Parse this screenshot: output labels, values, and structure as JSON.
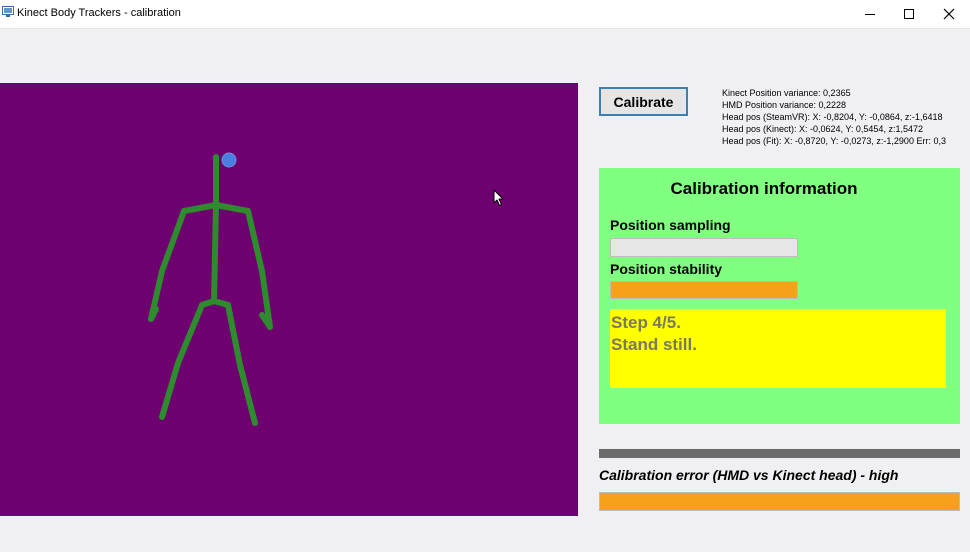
{
  "window": {
    "title": "Kinect Body Trackers - calibration",
    "controls": [
      "minimize-icon",
      "maximize-icon",
      "close-icon"
    ]
  },
  "toolbar": {
    "calibrate_label": "Calibrate"
  },
  "stats": {
    "lines": [
      "Kinect Position variance: 0,2365",
      "HMD Position variance: 0,2228",
      "Head pos (SteamVR): X: -0,8204, Y: -0,0864, z:-1,6418",
      "Head pos (Kinect): X: -0,0624, Y: 0,5454, z:1,5472",
      "Head pos (Fit): X: -0,8720, Y: -0,0273, z:-1,2900 Err: 0,3"
    ]
  },
  "calibration_info": {
    "title": "Calibration information",
    "position_sampling_label": "Position sampling",
    "position_sampling_progress": 0,
    "position_stability_label": "Position stability",
    "position_stability_progress": 1.0,
    "step_line1": "Step 4/5.",
    "step_line2": "Stand still."
  },
  "calibration_error": {
    "label": "Calibration error (HMD vs Kinect head) - high",
    "level": 1.0
  },
  "colors": {
    "viewport_bg": "#6f006f",
    "skeleton": "#2e8b2e",
    "head_marker": "#4a7ee0",
    "info_panel_bg": "#80ff80",
    "step_box_bg": "#ffff00",
    "progress_fill": "#f5a21a",
    "divider": "#6b6b6b"
  }
}
